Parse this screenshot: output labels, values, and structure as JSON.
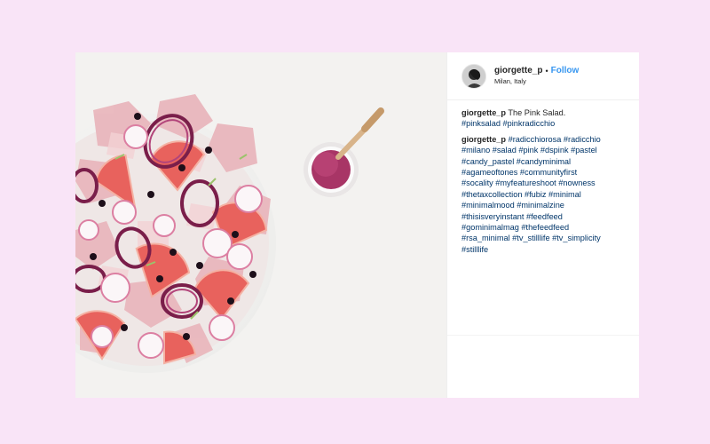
{
  "post": {
    "username": "giorgette_p",
    "separator": "•",
    "follow_label": "Follow",
    "location": "Milan, Italy",
    "caption": {
      "author": "giorgette_p",
      "text": "The Pink Salad.",
      "tags": "#pinksalad #pinkradicchio"
    },
    "comment": {
      "author": "giorgette_p",
      "first_line": "#radicchiorosa #radicchio",
      "lines": [
        "#milano #salad #pink #dspink #pastel",
        "#candy_pastel #candyminimal",
        "#agameoftones #communityfirst",
        "#socality #myfeatureshoot #nowness",
        "#thetaxcollection #fubiz #minimal",
        "#minimalmood #minimalzine",
        "#thisisveryinstant #feedfeed",
        "#gominimalmag #thefeedfeed",
        "#rsa_minimal #tv_stilllife #tv_simplicity",
        "#stilllife"
      ]
    }
  },
  "colors": {
    "page_bg": "#f9e4f7",
    "link": "#3897f0",
    "hashtag": "#003569"
  }
}
